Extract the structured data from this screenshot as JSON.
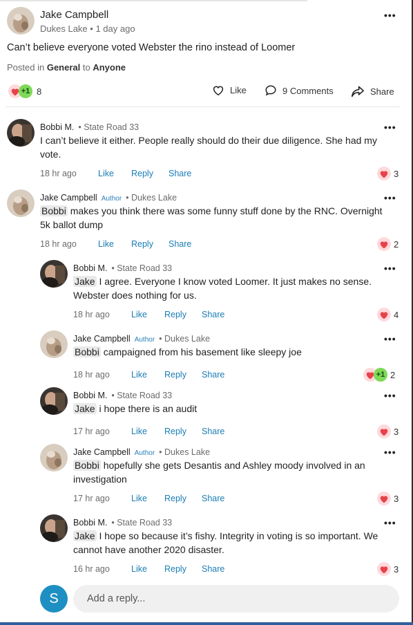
{
  "post": {
    "author": "Jake Campbell",
    "location": "Dukes Lake",
    "time": "1 day ago",
    "body": "Can’t believe everyone voted Webster the rino instead of Loomer",
    "posted_in_prefix": "Posted in",
    "category": "General",
    "posted_to_word": "to",
    "audience": "Anyone",
    "reaction_extra": "+1",
    "reaction_count": "8",
    "like_label": "Like",
    "comments_label": "9 Comments",
    "share_label": "Share"
  },
  "comment_actions": {
    "like": "Like",
    "reply": "Reply",
    "share": "Share"
  },
  "author_badge": "Author",
  "comments": [
    {
      "name": "Bobbi M.",
      "loc": "State Road 33",
      "author": false,
      "mention": "",
      "text": "I can’t believe it either. People really should do their due diligence. She had my vote.",
      "line1": "I can’t believe it either. People really should do their due diligence. She had my",
      "line2": "vote.",
      "time": "18 hr ago",
      "count": "3"
    },
    {
      "name": "Jake Campbell",
      "loc": "Dukes Lake",
      "author": true,
      "mention": "Bobbi",
      "line1": "makes you think there was some funny stuff done by the RNC. Overnight",
      "line2": "5k ballot dump",
      "time": "18 hr ago",
      "count": "2"
    },
    {
      "name": "Bobbi M.",
      "loc": "State Road 33",
      "author": false,
      "mention": "Jake",
      "line1": "I agree. Everyone I know voted Loomer. It just makes no sense.",
      "line2": "Webster does nothing for us.",
      "time": "18 hr ago",
      "count": "4"
    },
    {
      "name": "Jake Campbell",
      "loc": "Dukes Lake",
      "author": true,
      "mention": "Bobbi",
      "line1": "campaigned from his basement like sleepy joe",
      "line2": "",
      "time": "18 hr ago",
      "count": "2",
      "extra": "+1"
    },
    {
      "name": "Bobbi M.",
      "loc": "State Road 33",
      "author": false,
      "mention": "Jake",
      "line1": "i hope there is an audit",
      "line2": "",
      "time": "17 hr ago",
      "count": "3"
    },
    {
      "name": "Jake Campbell",
      "loc": "Dukes Lake",
      "author": true,
      "mention": "Bobbi",
      "line1": "hopefully she gets Desantis and Ashley moody involved in an",
      "line2": "investigation",
      "time": "17 hr ago",
      "count": "3"
    },
    {
      "name": "Bobbi M.",
      "loc": "State Road 33",
      "author": false,
      "mention": "Jake",
      "line1": "I hope so because it’s fishy. Integrity in voting is so important. We",
      "line2": "cannot have another 2020 disaster.",
      "time": "16 hr ago",
      "count": "3"
    }
  ],
  "reply_box": {
    "avatar_letter": "S",
    "placeholder": "Add a reply..."
  },
  "colors": {
    "link": "#1a7db5",
    "heart": "#e8414a",
    "plus": "#7ed957",
    "badge": "#2a7fb8"
  }
}
